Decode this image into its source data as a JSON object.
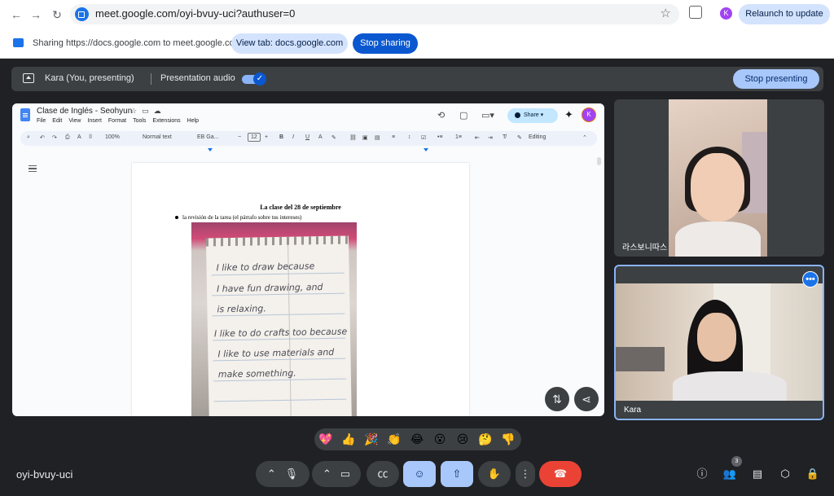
{
  "browser": {
    "url": "meet.google.com/oyi-bvuy-uci?authuser=0",
    "profile_initial": "K",
    "relaunch_label": "Relaunch to update"
  },
  "share_notice": {
    "text": "Sharing https://docs.google.com to meet.google.com",
    "view_tab_label": "View tab: docs.google.com",
    "stop_sharing_label": "Stop sharing"
  },
  "presenting_bar": {
    "label": "Kara (You, presenting)",
    "audio_label": "Presentation audio",
    "audio_on": true,
    "stop_presenting_label": "Stop presenting"
  },
  "doc": {
    "title": "Clase de Inglés - Seohyun",
    "menu": [
      "File",
      "Edit",
      "View",
      "Insert",
      "Format",
      "Tools",
      "Extensions",
      "Help"
    ],
    "share_label": "Share",
    "avatar_initial": "K",
    "toolbar": {
      "zoom": "100%",
      "style": "Normal text",
      "font": "EB Ga...",
      "font_size": "12",
      "mode": "Editing"
    },
    "heading": "La clase del 28 de septiembre",
    "bullet": "la revisión de la tarea (el párrafo sobre tus intereses)",
    "note_lines": [
      "I like to draw because",
      "I have fun drawing, and",
      "is relaxing.",
      "I like to do crafts too because",
      "I like to use materials and",
      "make something."
    ]
  },
  "participants": [
    {
      "name": "라스보니따스"
    },
    {
      "name": "Kara"
    }
  ],
  "reactions": [
    "💖",
    "👍",
    "🎉",
    "👏",
    "😂",
    "😮",
    "😢",
    "🤔",
    "👎"
  ],
  "meeting": {
    "code": "oyi-bvuy-uci",
    "people_count": "3"
  },
  "colors": {
    "meet_bg": "#202124",
    "accent": "#1a73e8",
    "end_call": "#ea4335",
    "active_button": "#a8c7fa"
  }
}
